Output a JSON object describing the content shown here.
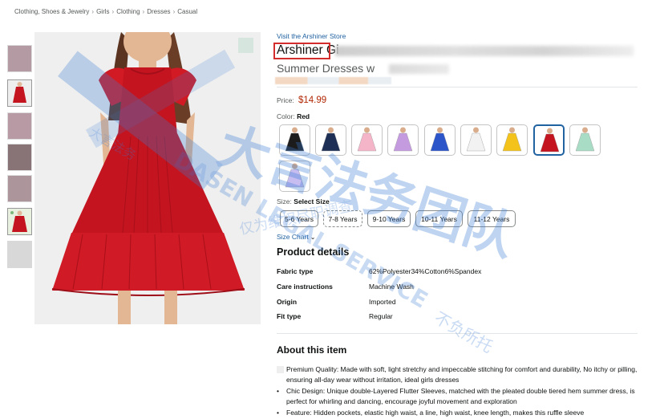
{
  "breadcrumb": [
    "Clothing, Shoes & Jewelry",
    "Girls",
    "Clothing",
    "Dresses",
    "Casual"
  ],
  "breadcrumb_sep": "›",
  "store_link": "Visit the Arshiner Store",
  "title": {
    "line1_visible": "Arshiner Gi",
    "line2_visible": "Summer Dresses w"
  },
  "price": {
    "label": "Price:",
    "value": "$14.99"
  },
  "color": {
    "label": "Color:",
    "selected": "Red"
  },
  "swatches": [
    {
      "name": "black",
      "color": "#1c1c1c"
    },
    {
      "name": "navy",
      "color": "#1e2f55"
    },
    {
      "name": "pink",
      "color": "#f4b5c8"
    },
    {
      "name": "purple",
      "color": "#c59be0"
    },
    {
      "name": "royal-blue",
      "color": "#2b55c8"
    },
    {
      "name": "white",
      "color": "#f2f2f2"
    },
    {
      "name": "yellow",
      "color": "#f3c31c"
    },
    {
      "name": "red",
      "color": "#c4141f",
      "selected": true
    },
    {
      "name": "mint-floral",
      "color": "#a8dcc4"
    },
    {
      "name": "lavender-floral",
      "color": "#c7bdf0"
    }
  ],
  "size": {
    "label": "Size:",
    "selected": "Select Size",
    "options": [
      "5-6 Years",
      "7-8 Years",
      "9-10 Years",
      "10-11 Years",
      "11-12 Years"
    ],
    "chart_link": "Size Chart",
    "chart_chevron": "⌄"
  },
  "product_details": {
    "heading": "Product details",
    "rows": [
      {
        "key": "Fabric type",
        "value": "62%Polyester34%Cotton6%Spandex"
      },
      {
        "key": "Care instructions",
        "value": "Machine Wash"
      },
      {
        "key": "Origin",
        "value": "Imported"
      },
      {
        "key": "Fit type",
        "value": "Regular"
      }
    ]
  },
  "about": {
    "heading": "About this item",
    "items": [
      "Premium Quality: Made with soft, light stretchy and impeccable stitching for comfort and durability, No itchy or pilling, ensuring all-day wear without irritation, ideal girls dresses",
      "Chic Design: Unique double-Layered Flutter Sleeves, matched with the pleated double tiered hem summer dress, is perfect for whirling and dancing, encourage joyful movement and exploration",
      "Feature: Hidden pockets, elastic high waist, a line, high waist, knee length, makes this ruffle sleeve"
    ]
  },
  "watermark": {
    "cn_large": "大言法务团队",
    "en_line": "DASEN LEGAL SERVICE",
    "cn_small1": "大言法务",
    "cn_small2": "仅为维权尽职调查",
    "cn_small3": "不负所托",
    "color": "#3c7dd6"
  },
  "colors": {
    "link": "#2162a1",
    "price": "#b12704",
    "highlight_box": "#d42d2d",
    "dress_red": "#c4141f"
  }
}
